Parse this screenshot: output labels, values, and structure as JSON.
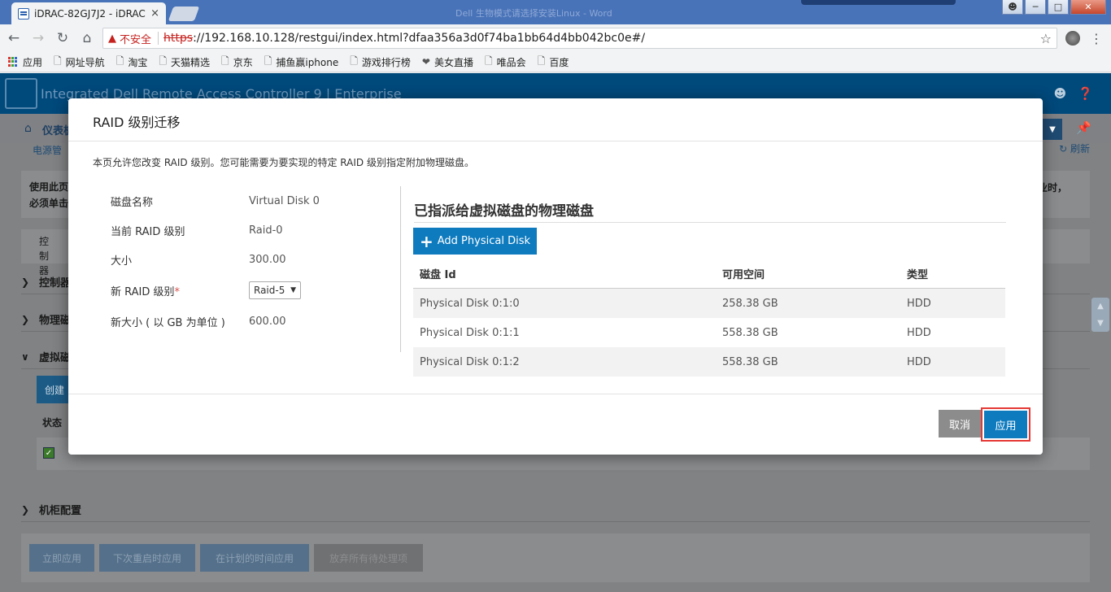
{
  "browser": {
    "tab_title": "iDRAC-82GJ7J2 - iDRAC",
    "tab_close": "×",
    "window_title_faded": "Dell 生物模式请选择安装Linux - Word",
    "insecure_label": "不安全",
    "url_scheme": "https",
    "url_rest": "://192.168.10.128/restgui/index.html?dfaa356a3d0f74ba1bb64d4bb042bc0e#/",
    "bookmarks": [
      {
        "label": "应用",
        "icon": "apps-icon"
      },
      {
        "label": "网址导航",
        "icon": "page-icon"
      },
      {
        "label": "淘宝",
        "icon": "page-icon"
      },
      {
        "label": "天猫精选",
        "icon": "page-icon"
      },
      {
        "label": "京东",
        "icon": "page-icon"
      },
      {
        "label": "捕鱼赢iphone",
        "icon": "page-icon"
      },
      {
        "label": "游戏排行榜",
        "icon": "page-icon"
      },
      {
        "label": "美女直播",
        "icon": "heart-icon"
      },
      {
        "label": "唯品会",
        "icon": "page-icon"
      },
      {
        "label": "百度",
        "icon": "page-icon"
      }
    ]
  },
  "idrac": {
    "title": "Integrated Dell Remote Access Controller 9",
    "edition": "Enterprise",
    "breadcrumb": "仪表板",
    "sub_link": "电源管",
    "refresh": "刷新",
    "panel_text_1": "使用此页",
    "panel_text_2": "必须单击",
    "panel_right": "业时，",
    "controller_label": "控制器",
    "sections": [
      "控制器",
      "物理磁",
      "虚拟磁",
      "机柜配置"
    ],
    "create_btn": "创建",
    "status_label": "状态",
    "bottom_buttons": [
      "立即应用",
      "下次重启时应用",
      "在计划的时间应用",
      "放弃所有待处理项"
    ]
  },
  "modal": {
    "title": "RAID 级别迁移",
    "description": "本页允许您改变 RAID 级别。您可能需要为要实现的特定 RAID 级别指定附加物理磁盘。",
    "fields": {
      "disk_name_label": "磁盘名称",
      "disk_name_value": "Virtual Disk 0",
      "current_raid_label": "当前 RAID 级别",
      "current_raid_value": "Raid-0",
      "size_label": "大小",
      "size_value": "300.00",
      "new_raid_label": "新 RAID 级别",
      "new_raid_required": "*",
      "new_raid_value": "Raid-5",
      "new_size_label": "新大小 ( 以 GB 为单位 )",
      "new_size_value": "600.00"
    },
    "assigned_title": "已指派给虚拟磁盘的物理磁盘",
    "add_button": "Add Physical Disk",
    "table": {
      "headers": [
        "磁盘 Id",
        "可用空间",
        "类型"
      ],
      "rows": [
        [
          "Physical Disk 0:1:0",
          "258.38 GB",
          "HDD"
        ],
        [
          "Physical Disk 0:1:1",
          "558.38 GB",
          "HDD"
        ],
        [
          "Physical Disk 0:1:2",
          "558.38 GB",
          "HDD"
        ]
      ]
    },
    "cancel_button": "取消",
    "apply_button": "应用",
    "highlight_color": "#e53935",
    "accent_color": "#0e7bbf"
  }
}
